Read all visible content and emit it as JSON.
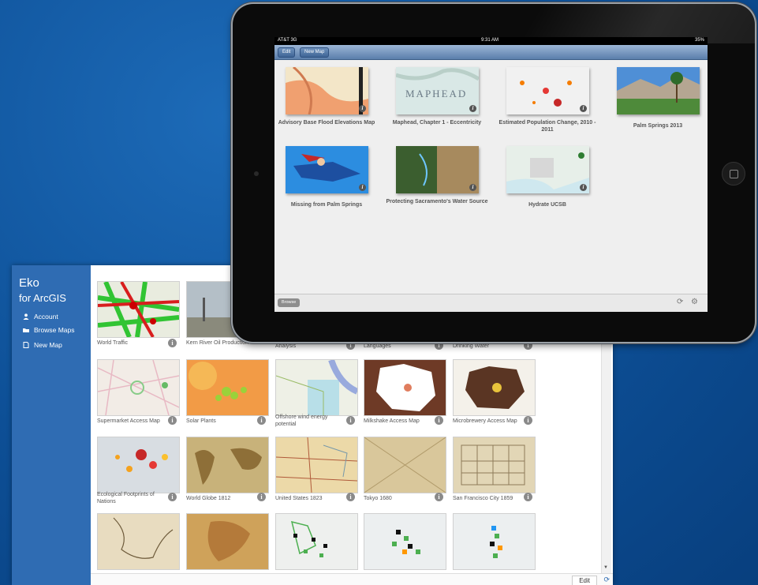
{
  "desktop": {
    "app_name": "Eko",
    "app_subtitle": "for ArcGIS",
    "nav": [
      {
        "label": "Account",
        "icon": "user-icon"
      },
      {
        "label": "Browse Maps",
        "icon": "folder-icon"
      },
      {
        "label": "New Map",
        "icon": "new-document-icon"
      }
    ],
    "tiles": [
      {
        "label": "World Traffic"
      },
      {
        "label": "Kern River Oil Production"
      },
      {
        "label": "Analysis"
      },
      {
        "label": "Languages"
      },
      {
        "label": "Drinking Water"
      },
      {
        "label": "Supermarket Access Map"
      },
      {
        "label": "Solar Plants"
      },
      {
        "label": "Offshore wind energy potential"
      },
      {
        "label": "Milkshake Access Map"
      },
      {
        "label": "Microbrewery Access Map"
      },
      {
        "label": "Ecological Footprints of Nations"
      },
      {
        "label": "World Globe 1812"
      },
      {
        "label": "United States 1823"
      },
      {
        "label": "Tokyo 1680"
      },
      {
        "label": "San Francisco City 1859"
      },
      {
        "label": ""
      },
      {
        "label": ""
      },
      {
        "label": ""
      },
      {
        "label": ""
      },
      {
        "label": ""
      }
    ],
    "info_glyph": "i",
    "edit_label": "Edit",
    "refresh_glyph": "⟳",
    "scroll_arrow": "▼"
  },
  "ipad": {
    "status": {
      "carrier": "AT&T 3G",
      "time": "9:31 AM",
      "battery": "35%"
    },
    "nav_buttons": {
      "edit": "Edit",
      "new_map": "New Map"
    },
    "maps": [
      {
        "label": "Advisory Base Flood Elevations Map"
      },
      {
        "label": "Maphead, Chapter 1 - Eccentricity"
      },
      {
        "label": "Estimated Population Change, 2010 - 2011"
      },
      {
        "label": "Palm Springs 2013"
      },
      {
        "label": "Missing from Palm Springs"
      },
      {
        "label": "Protecting Sacramento's Water Source"
      },
      {
        "label": "Hydrate UCSB"
      }
    ],
    "maphead_text": "MAPHEAD",
    "info_glyph": "i",
    "browse_label": "Browse",
    "refresh_glyph": "⟳",
    "settings_glyph": "⚙"
  }
}
